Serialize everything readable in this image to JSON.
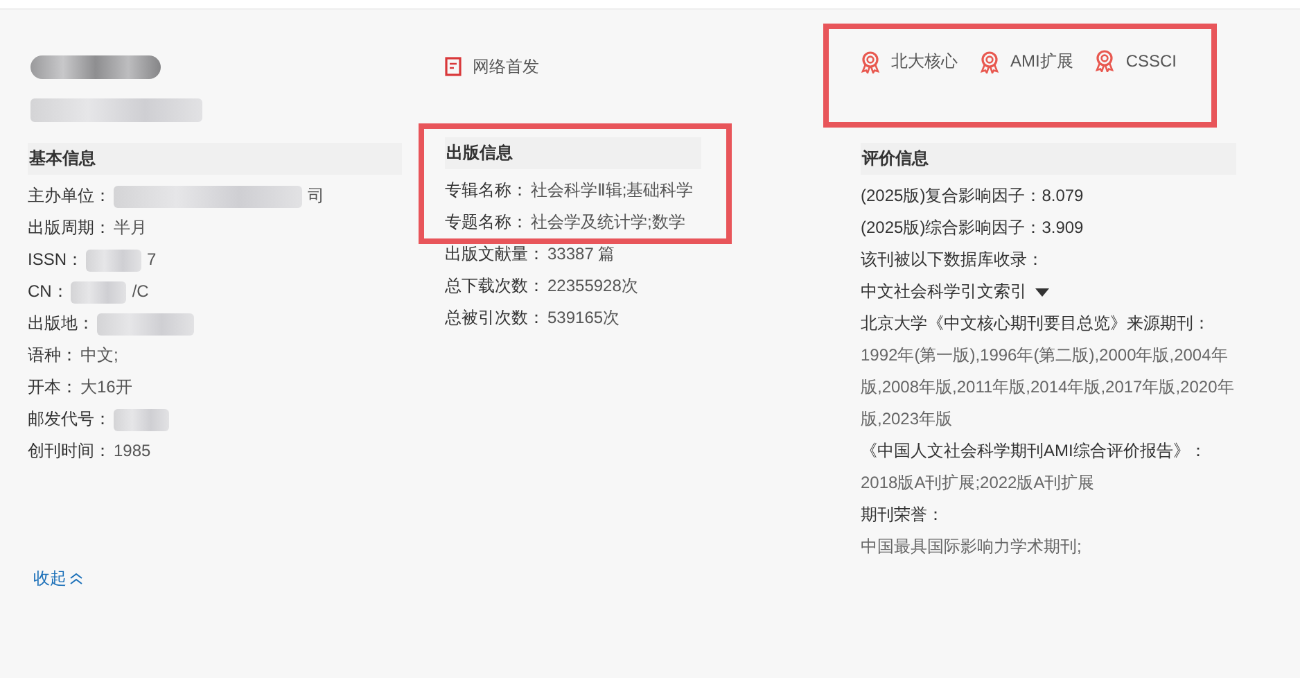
{
  "header": {
    "title": {
      "redacted": true
    },
    "subtitle": {
      "redacted": true
    }
  },
  "first_online": {
    "label": "网络首发"
  },
  "badges": {
    "highlighted": true,
    "items": [
      {
        "label": "北大核心"
      },
      {
        "label": "AMI扩展"
      },
      {
        "label": "CSSCI"
      }
    ]
  },
  "basic_info": {
    "title": "基本信息",
    "rows": [
      {
        "label": "主办单位：",
        "value": "司",
        "redacted": true
      },
      {
        "label": "出版周期：",
        "value": "半月",
        "redacted": false
      },
      {
        "label": "ISSN：",
        "value": "7",
        "redacted": true
      },
      {
        "label": "CN：",
        "value": "/C",
        "redacted": true
      },
      {
        "label": "出版地：",
        "redacted": true
      },
      {
        "label": "语种：",
        "value": "中文;",
        "redacted": false
      },
      {
        "label": "开本：",
        "value": "大16开",
        "redacted": false
      },
      {
        "label": "邮发代号：",
        "redacted": true
      },
      {
        "label": "创刊时间：",
        "value": "1985",
        "redacted": false
      }
    ]
  },
  "publication_info": {
    "title": "出版信息",
    "highlighted": true,
    "rows": [
      {
        "label": "专辑名称：",
        "value": "社会科学Ⅱ辑;基础科学"
      },
      {
        "label": "专题名称：",
        "value": "社会学及统计学;数学"
      }
    ],
    "rows_below_frame": [
      {
        "label": "出版文献量：",
        "value": "33387 篇"
      },
      {
        "label": "总下载次数：",
        "value": "22355928次"
      },
      {
        "label": "总被引次数：",
        "value": "539165次"
      }
    ]
  },
  "evaluation_info": {
    "title": "评价信息",
    "items": [
      {
        "kind": "text",
        "text": "(2025版)复合影响因子：8.079"
      },
      {
        "kind": "text",
        "text": "(2025版)综合影响因子：3.909"
      },
      {
        "kind": "text",
        "text": "该刊被以下数据库收录："
      },
      {
        "kind": "dropdown",
        "text": "中文社会科学引文索引"
      },
      {
        "kind": "text",
        "text": "北京大学《中文核心期刊要目总览》来源期刊："
      },
      {
        "kind": "muted",
        "text": "1992年(第一版),1996年(第二版),2000年版,2004年版,2008年版,2011年版,2014年版,2017年版,2020年版,2023年版"
      },
      {
        "kind": "text",
        "text": "《中国人文社会科学期刊AMI综合评价报告》："
      },
      {
        "kind": "muted",
        "text": "2018版A刊扩展;2022版A刊扩展"
      },
      {
        "kind": "text",
        "text": "期刊荣誉："
      },
      {
        "kind": "muted",
        "text": "中国最具国际影响力学术期刊;"
      }
    ]
  },
  "collapse_link": {
    "label": "收起"
  }
}
